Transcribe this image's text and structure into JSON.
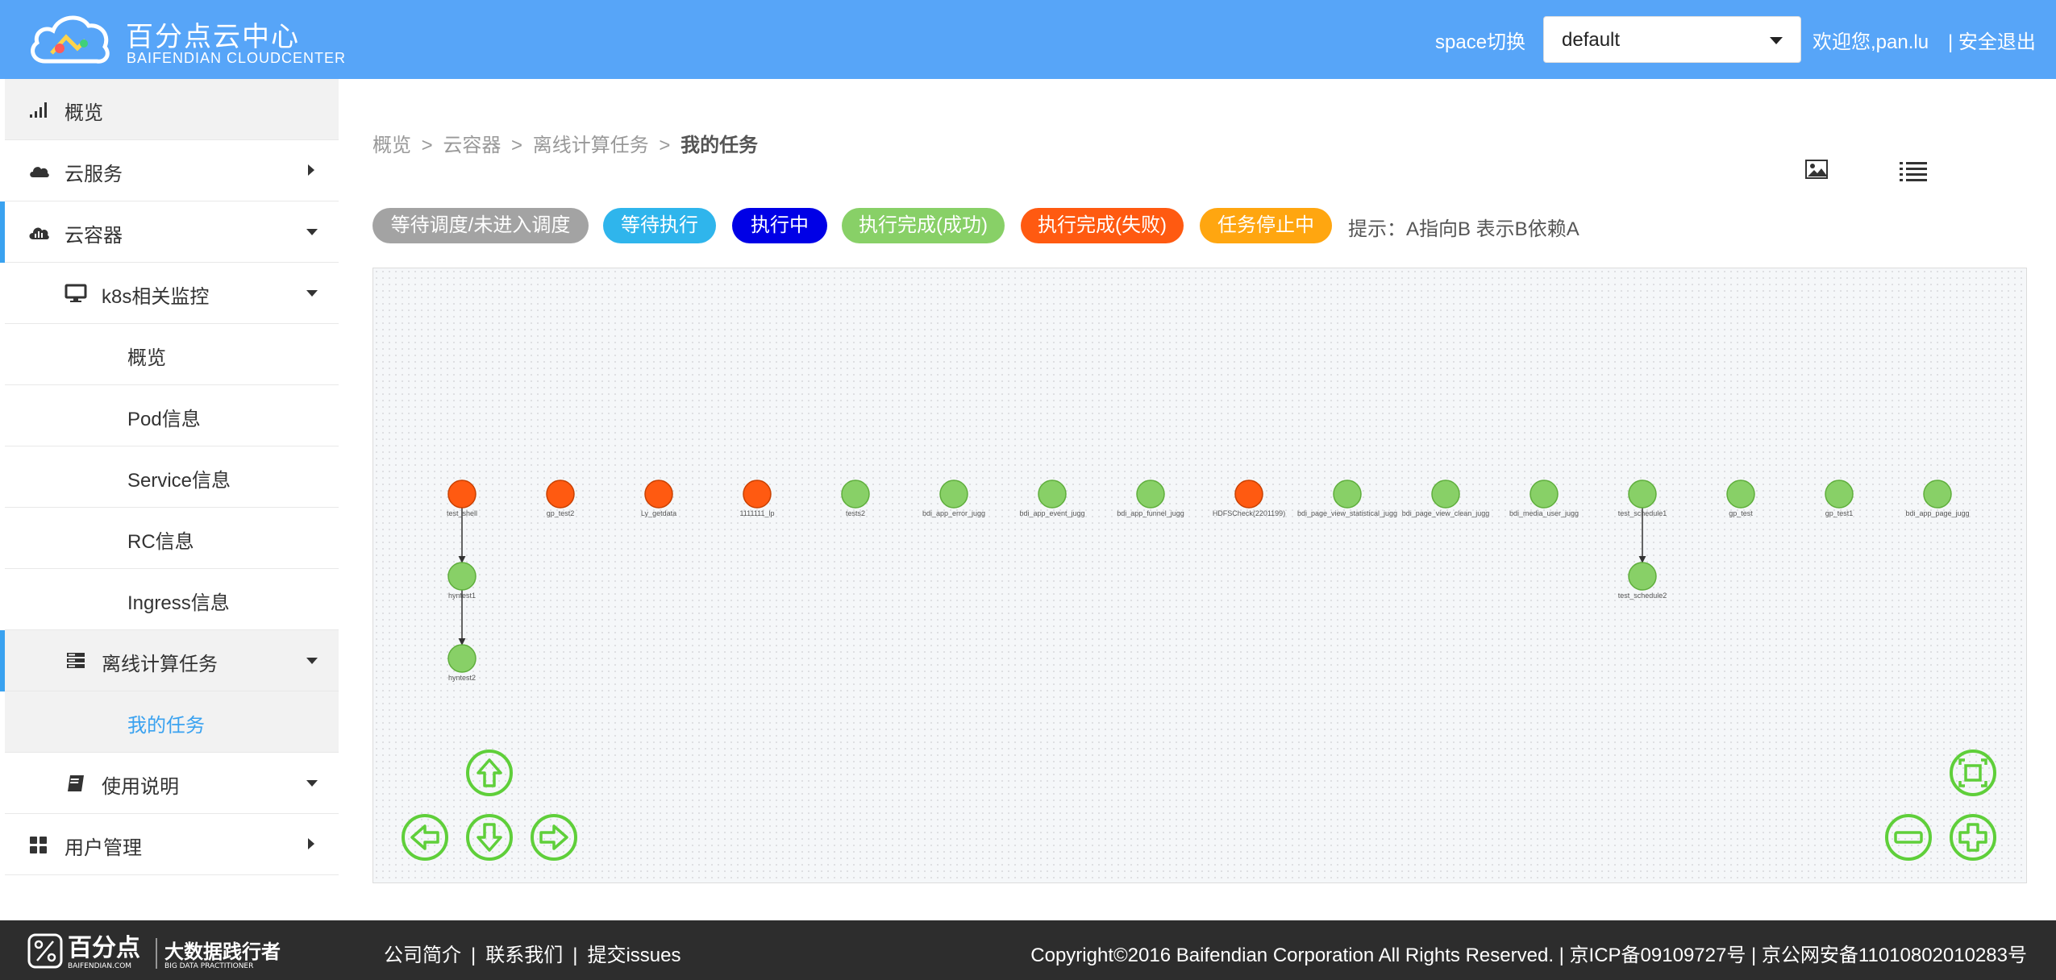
{
  "header": {
    "brand_cn": "百分点云中心",
    "brand_en": "BAIFENDIAN CLOUDCENTER",
    "space_label": "space切换",
    "space_selected": "default",
    "welcome": "欢迎您,pan.lu",
    "logout": "| 安全退出"
  },
  "sidebar": {
    "items": [
      {
        "label": "概览",
        "icon": "signal-icon"
      },
      {
        "label": "云服务",
        "icon": "cloud-icon"
      },
      {
        "label": "云容器",
        "icon": "cloud-dashboard-icon"
      },
      {
        "label": "k8s相关监控",
        "icon": "monitor-icon"
      },
      {
        "label": "概览"
      },
      {
        "label": "Pod信息"
      },
      {
        "label": "Service信息"
      },
      {
        "label": "RC信息"
      },
      {
        "label": "Ingress信息"
      },
      {
        "label": "离线计算任务",
        "icon": "server-icon"
      },
      {
        "label": "我的任务"
      },
      {
        "label": "使用说明",
        "icon": "book-icon"
      },
      {
        "label": "用户管理",
        "icon": "grid-icon"
      }
    ]
  },
  "breadcrumb": {
    "items": [
      "概览",
      "云容器",
      "离线计算任务"
    ],
    "current": "我的任务",
    "separator": ">"
  },
  "legend": [
    {
      "label": "等待调度/未进入调度",
      "color": "#a3a3a3"
    },
    {
      "label": "等待执行",
      "color": "#2fb5ec"
    },
    {
      "label": "执行中",
      "color": "#0000e6"
    },
    {
      "label": "执行完成(成功)",
      "color": "#88d067"
    },
    {
      "label": "执行完成(失败)",
      "color": "#ff5a11"
    },
    {
      "label": "任务停止中",
      "color": "#ffa610"
    }
  ],
  "hint": "提示：A指向B 表示B依赖A",
  "graph": {
    "colors": {
      "success": "#88d067",
      "failed": "#ff5a11"
    },
    "nodes": [
      {
        "id": "n1",
        "label": "test_shell",
        "status": "failed"
      },
      {
        "id": "n2",
        "label": "gp_test2",
        "status": "failed"
      },
      {
        "id": "n3",
        "label": "Ly_getdata",
        "status": "failed"
      },
      {
        "id": "n4",
        "label": "1111111_lp",
        "status": "failed"
      },
      {
        "id": "n5",
        "label": "tests2",
        "status": "success"
      },
      {
        "id": "n6",
        "label": "bdi_app_error_jugg",
        "status": "success"
      },
      {
        "id": "n7",
        "label": "bdi_app_event_jugg",
        "status": "success"
      },
      {
        "id": "n8",
        "label": "bdi_app_funnel_jugg",
        "status": "success"
      },
      {
        "id": "n9",
        "label": "HDFSCheck(2201199)",
        "status": "failed"
      },
      {
        "id": "n10",
        "label": "bdi_page_view_statistical_jugg",
        "status": "success"
      },
      {
        "id": "n11",
        "label": "bdi_page_view_clean_jugg",
        "status": "success"
      },
      {
        "id": "n12",
        "label": "bdi_media_user_jugg",
        "status": "success"
      },
      {
        "id": "n13",
        "label": "test_schedule1",
        "status": "success"
      },
      {
        "id": "n14",
        "label": "gp_test",
        "status": "success"
      },
      {
        "id": "n15",
        "label": "gp_test1",
        "status": "success"
      },
      {
        "id": "n16",
        "label": "bdi_app_page_jugg",
        "status": "success"
      },
      {
        "id": "n17",
        "label": "hyntest1",
        "status": "success"
      },
      {
        "id": "n18",
        "label": "hyntest2",
        "status": "success"
      },
      {
        "id": "n19",
        "label": "test_schedule2",
        "status": "success"
      }
    ],
    "edges": [
      [
        "n1",
        "n17"
      ],
      [
        "n17",
        "n18"
      ],
      [
        "n13",
        "n19"
      ]
    ]
  },
  "footer": {
    "logo_text": "百分点 大数据践行者",
    "links": [
      "公司简介",
      "联系我们",
      "提交issues"
    ],
    "copyright": "Copyright©2016 Baifendian Corporation All Rights Reserved.  |  京ICP备09109727号  |  京公网安备11010802010283号"
  }
}
